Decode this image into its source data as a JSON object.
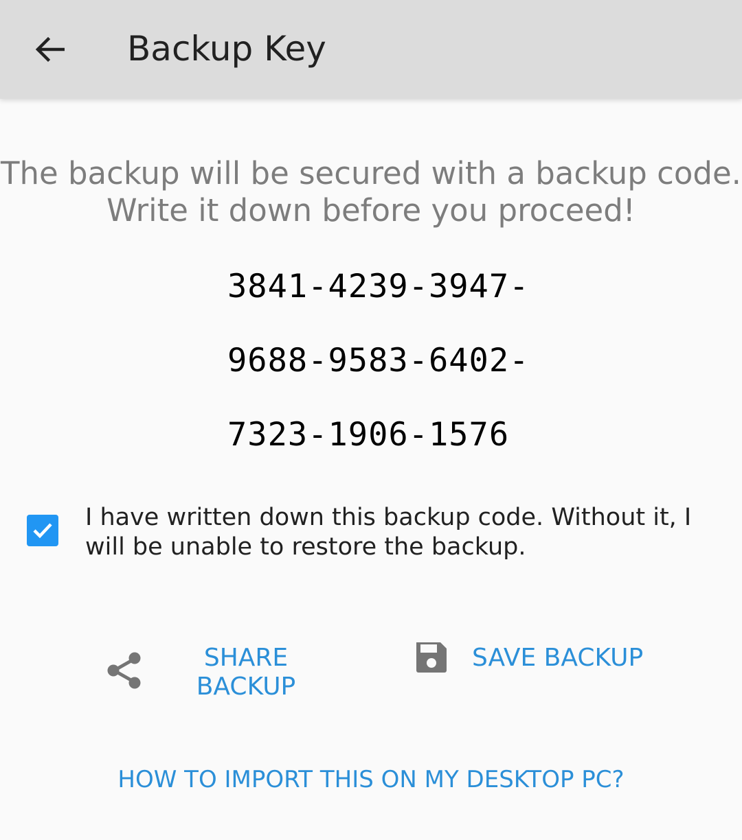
{
  "app_bar": {
    "back_icon": "arrow-left-icon",
    "title": "Backup Key"
  },
  "intro": {
    "line1": "The backup will be secured with a backup code.",
    "line2": "Write it down before you proceed!"
  },
  "backup_code": {
    "lines": [
      "3841-4239-3947-",
      "9688-9583-6402-",
      "7323-1906-1576"
    ]
  },
  "confirmation": {
    "checked": true,
    "text": "I have written down this backup code. Without it, I will be unable to restore the backup."
  },
  "actions": {
    "share": {
      "icon": "share-icon",
      "line1": "SHARE",
      "line2": "BACKUP"
    },
    "save": {
      "icon": "floppy-disk-icon",
      "label": "SAVE BACKUP"
    }
  },
  "help_link": "HOW TO IMPORT THIS ON MY DESKTOP PC?",
  "colors": {
    "accent": "#2196f3",
    "link": "#2b8fd8",
    "app_bar": "#dcdcdc",
    "icon_gray": "#757575"
  }
}
